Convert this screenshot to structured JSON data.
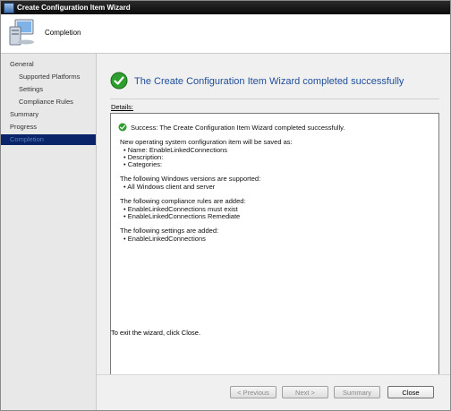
{
  "window": {
    "title": "Create Configuration Item Wizard"
  },
  "header": {
    "page_title": "Completion"
  },
  "sidebar": {
    "items": [
      {
        "label": "General"
      },
      {
        "label": "Supported Platforms"
      },
      {
        "label": "Settings"
      },
      {
        "label": "Compliance Rules"
      },
      {
        "label": "Summary"
      },
      {
        "label": "Progress"
      },
      {
        "label": "Completion"
      }
    ]
  },
  "main": {
    "headline": "The Create Configuration Item Wizard completed successfully",
    "details_label": "Details:",
    "details_lines": [
      "Success: The Create Configuration Item Wizard completed successfully.",
      "New operating system configuration item will be saved as:",
      "Name: EnableLinkedConnections",
      "Description:",
      "Categories:",
      "The following Windows versions are supported:",
      "All Windows client and server",
      "The following compliance rules are added:",
      "EnableLinkedConnections must exist",
      "EnableLinkedConnections Remediate",
      "The following settings are added:",
      "EnableLinkedConnections"
    ],
    "exit_text": "To exit the wizard, click Close."
  },
  "buttons": {
    "previous": "< Previous",
    "next": "Next >",
    "summary": "Summary",
    "close": "Close"
  },
  "colors": {
    "selected_nav_bg": "#0a246a",
    "headline": "#1f4e9c",
    "success_green": "#2e9e2e"
  },
  "icons": {
    "window": "app-icon",
    "header": "computer-icon",
    "success": "checkmark-circle-icon"
  }
}
